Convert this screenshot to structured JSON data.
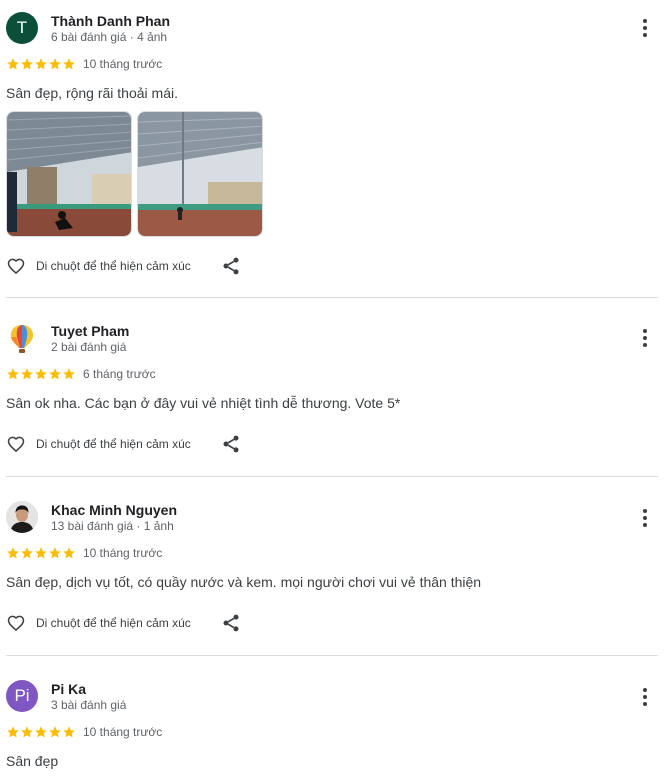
{
  "reviews": [
    {
      "avatar_letter": "T",
      "avatar_color": "#0b4f3b",
      "name": "Thành Danh Phan",
      "meta": "6 bài đánh giá · 4 ảnh",
      "rating": 5,
      "time": "10 tháng trước",
      "text": "Sân đẹp, rộng rãi thoải mái.",
      "photos": [
        "court-photo-1",
        "court-photo-2"
      ],
      "react_hint": "Di chuột để thể hiện cảm xúc"
    },
    {
      "avatar_letter": "",
      "avatar_color": "#ffffff",
      "name": "Tuyet Pham",
      "meta": "2 bài đánh giá",
      "rating": 5,
      "time": "6 tháng trước",
      "text": "Sân ok nha. Các bạn ở đây vui vẻ nhiệt tình dễ thương. Vote 5*",
      "react_hint": "Di chuột để thể hiện cảm xúc"
    },
    {
      "avatar_letter": "",
      "avatar_color": "#e8e8e8",
      "name": "Khac Minh Nguyen",
      "meta": "13 bài đánh giá · 1 ảnh",
      "rating": 5,
      "time": "10 tháng trước",
      "text": "Sân đẹp, dịch vụ tốt, có quầy nước và kem. mọi người chơi vui vẻ thân thiện",
      "react_hint": "Di chuột để thể hiện cảm xúc"
    },
    {
      "avatar_letter": "Pi",
      "avatar_color": "#7e57c2",
      "name": "Pi Ka",
      "meta": "3 bài đánh giá",
      "rating": 5,
      "time": "10 tháng trước",
      "text": "Sân đẹp"
    }
  ],
  "colors": {
    "star": "#fbbc04",
    "text_primary": "#202124",
    "text_secondary": "#5f6368",
    "divider": "#dadce0"
  },
  "icons": {
    "more": "more-vert-icon",
    "heart": "heart-outline-icon",
    "share": "share-icon",
    "star": "star-icon"
  }
}
